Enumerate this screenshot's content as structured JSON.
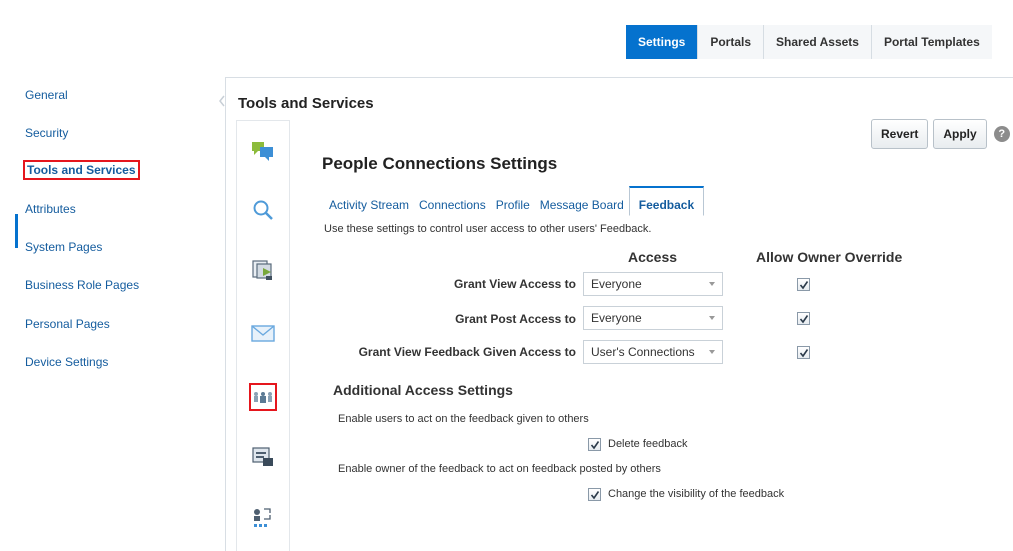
{
  "top_tabs": [
    {
      "label": "Settings"
    },
    {
      "label": "Portals"
    },
    {
      "label": "Shared Assets"
    },
    {
      "label": "Portal Templates"
    }
  ],
  "sidebar": {
    "items": [
      {
        "label": "General"
      },
      {
        "label": "Security"
      },
      {
        "label": "Tools and Services"
      },
      {
        "label": "Attributes"
      },
      {
        "label": "System Pages"
      },
      {
        "label": "Business Role Pages"
      },
      {
        "label": "Personal Pages"
      },
      {
        "label": "Device Settings"
      }
    ]
  },
  "page": {
    "title": "Tools and Services"
  },
  "icon_strip": [
    {
      "icon": "discussions-icon"
    },
    {
      "icon": "search-icon"
    },
    {
      "icon": "documents-icon"
    },
    {
      "icon": "mail-icon"
    },
    {
      "icon": "people-connections-icon"
    },
    {
      "icon": "events-icon"
    },
    {
      "icon": "activity-graph-icon"
    }
  ],
  "actions": {
    "revert_label": "Revert",
    "apply_label": "Apply",
    "help_label": "?"
  },
  "settings": {
    "title": "People Connections Settings",
    "subtabs": [
      {
        "label": "Activity Stream"
      },
      {
        "label": "Connections"
      },
      {
        "label": "Profile"
      },
      {
        "label": "Message Board"
      },
      {
        "label": "Feedback"
      }
    ],
    "description": "Use these settings to control user access to other users' Feedback.",
    "columns": {
      "access": "Access",
      "override": "Allow Owner Override"
    },
    "rows": [
      {
        "label": "Grant View Access to",
        "value": "Everyone",
        "override_checked": true
      },
      {
        "label": "Grant Post Access to",
        "value": "Everyone",
        "override_checked": true
      },
      {
        "label": "Grant View Feedback Given Access to",
        "value": "User's Connections",
        "override_checked": true
      }
    ],
    "additional": {
      "title": "Additional Access Settings",
      "group1_text": "Enable users to act on the feedback given to others",
      "delete_label": "Delete feedback",
      "group2_text": "Enable owner of the feedback to act on feedback posted by others",
      "visibility_label": "Change the visibility of the feedback"
    }
  },
  "colors": {
    "accent": "#0572ce",
    "highlight_border": "#e5161d",
    "link": "#145c9e"
  }
}
